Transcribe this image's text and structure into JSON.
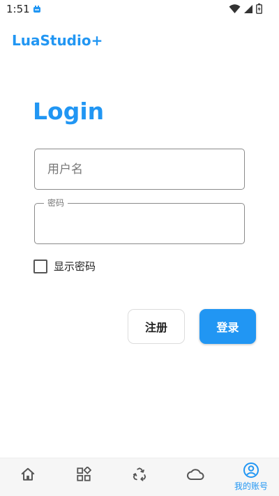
{
  "status_bar": {
    "time": "1:51"
  },
  "app_bar": {
    "title": "LuaStudio+"
  },
  "login": {
    "heading": "Login",
    "username_placeholder": "用户名",
    "password_label": "密码",
    "show_password_label": "显示密码",
    "register_label": "注册",
    "login_label": "登录"
  },
  "bottom_nav": {
    "items": [
      {
        "icon": "home-icon"
      },
      {
        "icon": "apps-grid-icon"
      },
      {
        "icon": "recycle-icon"
      },
      {
        "icon": "cloud-icon"
      },
      {
        "icon": "account-circle-icon",
        "label": "我的账号",
        "active": true
      }
    ]
  },
  "colors": {
    "accent": "#2196f3",
    "nav_background": "#f6f6f6"
  }
}
